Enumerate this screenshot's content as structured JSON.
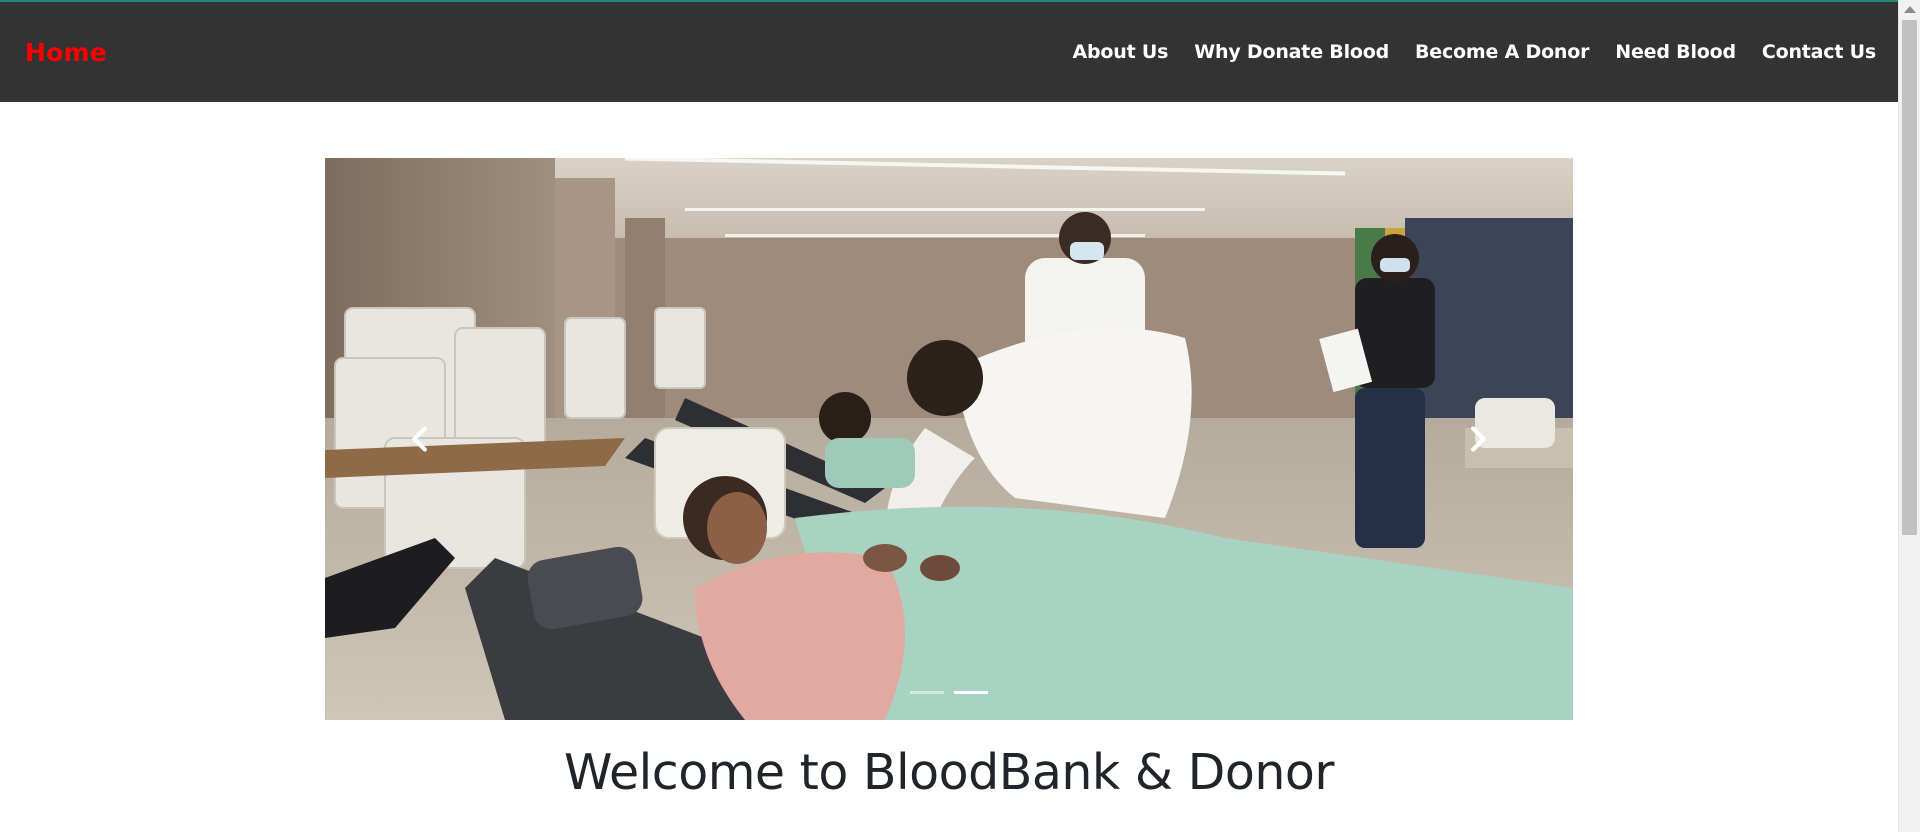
{
  "navbar": {
    "brand": "Home",
    "links": [
      {
        "label": "About Us"
      },
      {
        "label": "Why Donate Blood"
      },
      {
        "label": "Become A Donor"
      },
      {
        "label": "Need Blood"
      },
      {
        "label": "Contact Us"
      }
    ]
  },
  "carousel": {
    "prev_icon": "chevron-left-icon",
    "next_icon": "chevron-right-icon",
    "slide_count": 2,
    "active_slide": 2
  },
  "main": {
    "heading": "Welcome to BloodBank & Donor"
  },
  "colors": {
    "navbar_bg": "#333333",
    "brand": "#ff0000",
    "nav_text": "#ffffff",
    "accent_line": "#1f8a7a",
    "heading_text": "#212529"
  }
}
